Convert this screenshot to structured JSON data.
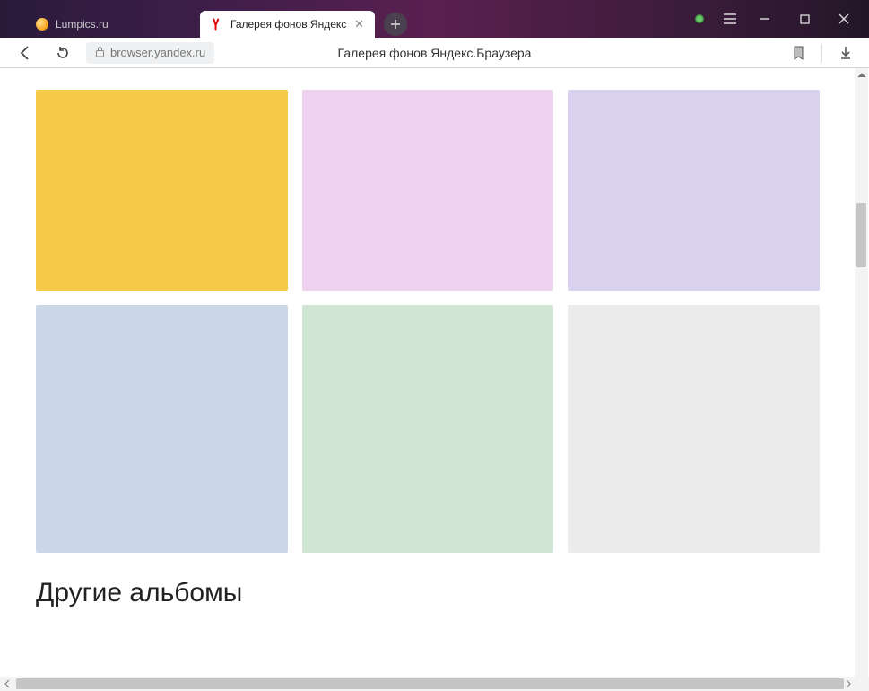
{
  "tabs": [
    {
      "label": "Lumpics.ru",
      "active": false
    },
    {
      "label": "Галерея фонов Яндекс",
      "active": true
    }
  ],
  "toolbar": {
    "url": "browser.yandex.ru",
    "page_title": "Галерея фонов Яндекс.Браузера"
  },
  "content": {
    "swatches": [
      {
        "color": "#f7c948"
      },
      {
        "color": "#efd2ef"
      },
      {
        "color": "#d8d2ef"
      },
      {
        "color": "#cbd7e6"
      },
      {
        "color": "#d1e5d3"
      },
      {
        "color": "#ebebeb"
      }
    ],
    "section_heading": "Другие альбомы"
  }
}
